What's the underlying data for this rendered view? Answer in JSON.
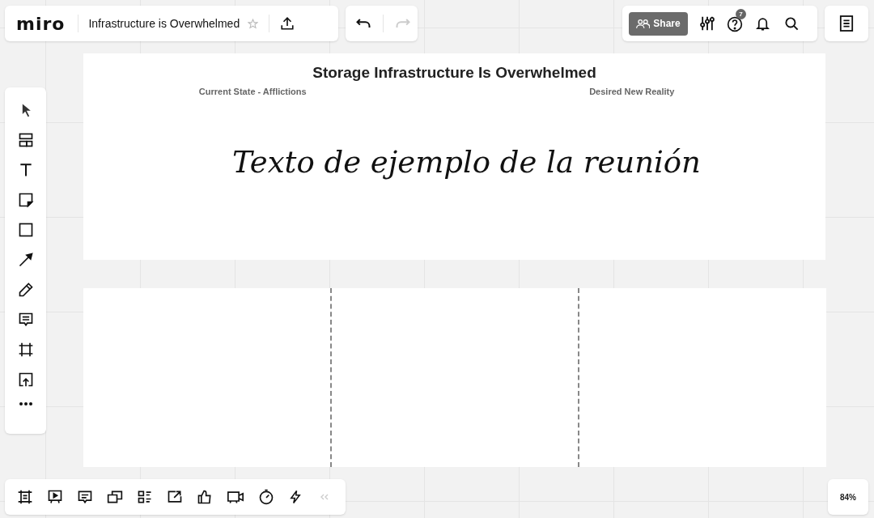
{
  "header": {
    "logo": "miro",
    "board_title": "Infrastructure is Overwhelmed",
    "starred": false,
    "undo": {
      "disabled": false
    },
    "redo": {
      "disabled": true
    }
  },
  "top_right": {
    "share_label": "Share",
    "help_badge": "7"
  },
  "frames": [
    {
      "title": "Storage Infrastructure Is Overwhelmed",
      "column_labels": [
        "Current State - Afflictions",
        "Desired New Reality"
      ],
      "note": "Texto de ejemplo de la reunión"
    },
    {
      "kind": "three_column_board"
    }
  ],
  "zoom": "84%"
}
